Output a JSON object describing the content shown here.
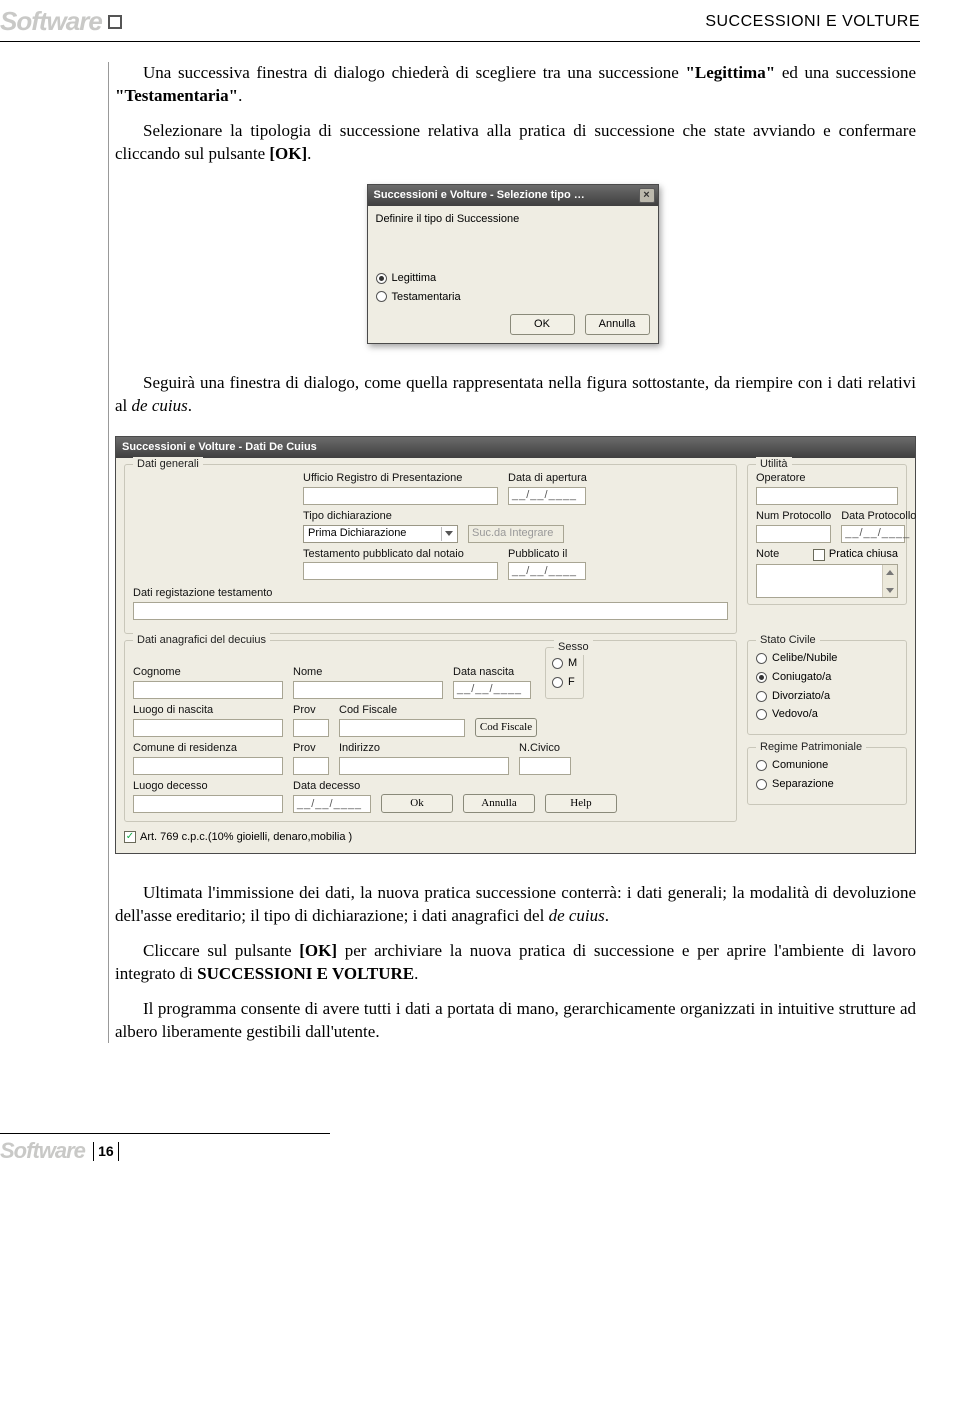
{
  "header": {
    "software_label": "Software",
    "page_title": "SUCCESSIONI E VOLTURE"
  },
  "paras": {
    "p1a": "Una successiva finestra di dialogo chiederà di scegliere tra una successione ",
    "p1b": "\"Legittima\"",
    "p1c": " ed una successione ",
    "p1d": "\"Testamentaria\"",
    "p1e": ".",
    "p2a": "Selezionare la tipologia di successione relativa alla pratica di successione che state avviando e confermare cliccando sul pulsante ",
    "p2b": "[OK]",
    "p2c": ".",
    "p3a": "Seguirà una finestra di dialogo, come quella rappresentata nella figura sottostante, da riempire con i dati relativi al ",
    "p3b": "de cuius",
    "p3c": ".",
    "p4a": "Ultimata l'immissione dei dati, la nuova pratica successione conterrà: i dati generali; la modalità di devoluzione dell'asse ereditario; il tipo di dichiarazione; i dati anagrafici del ",
    "p4b": "de cuius",
    "p4c": ".",
    "p5a": "Cliccare sul pulsante ",
    "p5b": "[OK]",
    "p5c": " per archiviare la nuova pratica di successione e per aprire l'ambiente di lavoro integrato di ",
    "p5d": "SUCCESSIONI E VOLTURE",
    "p5e": ".",
    "p6": "Il programma consente di avere tutti i dati a portata di mano, gerarchicamente organizzati in intuitive strutture ad albero liberamente gestibili dall'utente."
  },
  "dlg1": {
    "title": "Successioni e Volture - Selezione tipo …",
    "subtitle": "Definire il tipo di Successione",
    "opt1": "Legittima",
    "opt2": "Testamentaria",
    "ok": "OK",
    "cancel": "Annulla"
  },
  "dlg2": {
    "title": "Successioni e Volture - Dati De Cuius",
    "fs_generali": "Dati generali",
    "lbl_ufficio": "Ufficio Registro di Presentazione",
    "lbl_data_apertura": "Data di apertura",
    "date_blank": "__/__/____",
    "lbl_tipo_dich": "Tipo dichiarazione",
    "sel_tipo_val": "Prima Dichiarazione",
    "btn_suc_integr": "Suc.da Integrare",
    "lbl_testamento": "Testamento pubblicato dal notaio",
    "lbl_pubblicato": "Pubblicato il",
    "lbl_dati_reg": "Dati registazione testamento",
    "fs_utilita": "Utilità",
    "lbl_operatore": "Operatore",
    "lbl_num_prot": "Num Protocollo",
    "lbl_data_prot": "Data Protocollo",
    "lbl_note": "Note",
    "cb_pratica_chiusa": "Pratica chiusa",
    "fs_anagrafici": "Dati anagrafici del decuius",
    "lbl_cognome": "Cognome",
    "lbl_nome": "Nome",
    "lbl_data_nascita": "Data nascita",
    "lbl_luogo_nascita": "Luogo di nascita",
    "lbl_prov": "Prov",
    "lbl_cod_fisc": "Cod Fiscale",
    "btn_cod_fisc": "Cod Fiscale",
    "lbl_comune_res": "Comune di residenza",
    "lbl_indirizzo": "Indirizzo",
    "lbl_ncivico": "N.Civico",
    "lbl_luogo_dec": "Luogo decesso",
    "lbl_data_dec": "Data decesso",
    "fs_sesso": "Sesso",
    "opt_m": "M",
    "opt_f": "F",
    "fs_stato_civ": "Stato Civile",
    "sc_celibe": "Celibe/Nubile",
    "sc_coniug": "Coniugato/a",
    "sc_divorz": "Divorziato/a",
    "sc_vedovo": "Vedovo/a",
    "fs_regime": "Regime Patrimoniale",
    "rp_com": "Comunione",
    "rp_sep": "Separazione",
    "cb_art769": "Art. 769 c.p.c.(10% gioielli, denaro,mobilia )",
    "btn_ok": "Ok",
    "btn_annulla": "Annulla",
    "btn_help": "Help"
  },
  "footer": {
    "page_num": "16"
  }
}
